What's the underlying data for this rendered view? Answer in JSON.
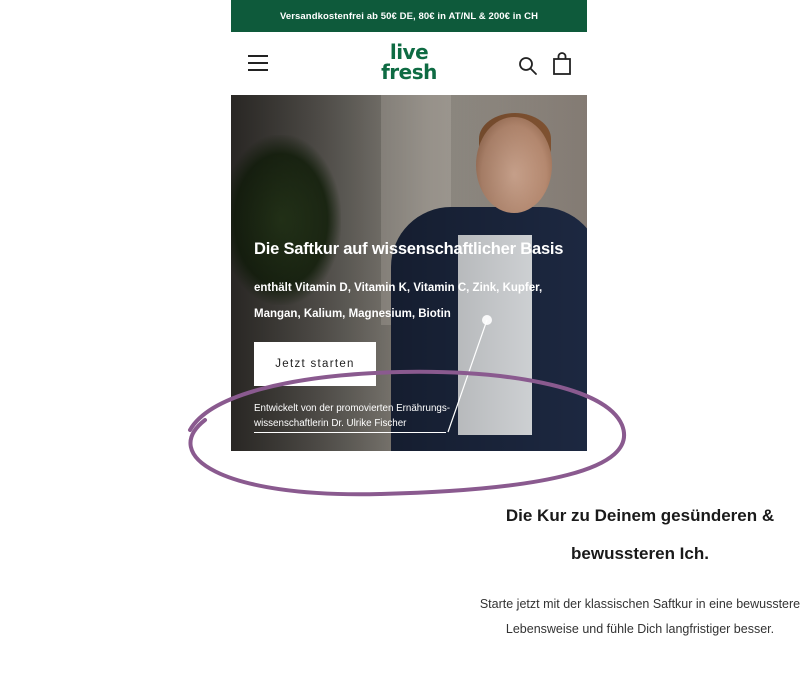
{
  "promo_bar": {
    "text": "Versandkostenfrei ab 50€ DE, 80€ in AT/NL & 200€ in CH"
  },
  "header": {
    "logo_line1": "live",
    "logo_line2": "fresh",
    "icons": {
      "menu": "menu-icon",
      "search": "search-icon",
      "cart": "shopping-bag-icon"
    }
  },
  "hero": {
    "title": "Die Saftkur auf wissenschaftlicher Basis",
    "subtitle": "enthält Vitamin D, Vitamin K, Vitamin C, Zink, Kupfer, Mangan, Kalium, Magnesium, Biotin",
    "cta_label": "Jetzt starten",
    "developer_note": "Entwickelt von der promovierten Ernährungs-wissenschaftlerin Dr. Ulrike Fischer"
  },
  "intro": {
    "title": "Die Kur zu Deinem gesünderen & bewussteren Ich.",
    "text": "Starte jetzt mit der klassischen Saftkur in eine bewusstere Lebensweise und fühle Dich langfristiger besser."
  },
  "colors": {
    "brand_green": "#0e5a3b",
    "logo_green": "#0e6b43",
    "annotation_purple": "#8a5a8f"
  }
}
